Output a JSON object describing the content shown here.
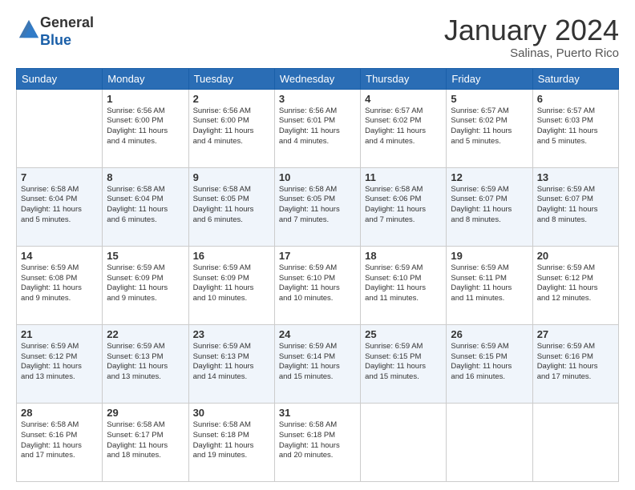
{
  "header": {
    "logo_general": "General",
    "logo_blue": "Blue",
    "month_title": "January 2024",
    "location": "Salinas, Puerto Rico"
  },
  "days_of_week": [
    "Sunday",
    "Monday",
    "Tuesday",
    "Wednesday",
    "Thursday",
    "Friday",
    "Saturday"
  ],
  "weeks": [
    [
      {
        "day": "",
        "info": ""
      },
      {
        "day": "1",
        "info": "Sunrise: 6:56 AM\nSunset: 6:00 PM\nDaylight: 11 hours\nand 4 minutes."
      },
      {
        "day": "2",
        "info": "Sunrise: 6:56 AM\nSunset: 6:00 PM\nDaylight: 11 hours\nand 4 minutes."
      },
      {
        "day": "3",
        "info": "Sunrise: 6:56 AM\nSunset: 6:01 PM\nDaylight: 11 hours\nand 4 minutes."
      },
      {
        "day": "4",
        "info": "Sunrise: 6:57 AM\nSunset: 6:02 PM\nDaylight: 11 hours\nand 4 minutes."
      },
      {
        "day": "5",
        "info": "Sunrise: 6:57 AM\nSunset: 6:02 PM\nDaylight: 11 hours\nand 5 minutes."
      },
      {
        "day": "6",
        "info": "Sunrise: 6:57 AM\nSunset: 6:03 PM\nDaylight: 11 hours\nand 5 minutes."
      }
    ],
    [
      {
        "day": "7",
        "info": "Sunrise: 6:58 AM\nSunset: 6:04 PM\nDaylight: 11 hours\nand 5 minutes."
      },
      {
        "day": "8",
        "info": "Sunrise: 6:58 AM\nSunset: 6:04 PM\nDaylight: 11 hours\nand 6 minutes."
      },
      {
        "day": "9",
        "info": "Sunrise: 6:58 AM\nSunset: 6:05 PM\nDaylight: 11 hours\nand 6 minutes."
      },
      {
        "day": "10",
        "info": "Sunrise: 6:58 AM\nSunset: 6:05 PM\nDaylight: 11 hours\nand 7 minutes."
      },
      {
        "day": "11",
        "info": "Sunrise: 6:58 AM\nSunset: 6:06 PM\nDaylight: 11 hours\nand 7 minutes."
      },
      {
        "day": "12",
        "info": "Sunrise: 6:59 AM\nSunset: 6:07 PM\nDaylight: 11 hours\nand 8 minutes."
      },
      {
        "day": "13",
        "info": "Sunrise: 6:59 AM\nSunset: 6:07 PM\nDaylight: 11 hours\nand 8 minutes."
      }
    ],
    [
      {
        "day": "14",
        "info": "Sunrise: 6:59 AM\nSunset: 6:08 PM\nDaylight: 11 hours\nand 9 minutes."
      },
      {
        "day": "15",
        "info": "Sunrise: 6:59 AM\nSunset: 6:09 PM\nDaylight: 11 hours\nand 9 minutes."
      },
      {
        "day": "16",
        "info": "Sunrise: 6:59 AM\nSunset: 6:09 PM\nDaylight: 11 hours\nand 10 minutes."
      },
      {
        "day": "17",
        "info": "Sunrise: 6:59 AM\nSunset: 6:10 PM\nDaylight: 11 hours\nand 10 minutes."
      },
      {
        "day": "18",
        "info": "Sunrise: 6:59 AM\nSunset: 6:10 PM\nDaylight: 11 hours\nand 11 minutes."
      },
      {
        "day": "19",
        "info": "Sunrise: 6:59 AM\nSunset: 6:11 PM\nDaylight: 11 hours\nand 11 minutes."
      },
      {
        "day": "20",
        "info": "Sunrise: 6:59 AM\nSunset: 6:12 PM\nDaylight: 11 hours\nand 12 minutes."
      }
    ],
    [
      {
        "day": "21",
        "info": "Sunrise: 6:59 AM\nSunset: 6:12 PM\nDaylight: 11 hours\nand 13 minutes."
      },
      {
        "day": "22",
        "info": "Sunrise: 6:59 AM\nSunset: 6:13 PM\nDaylight: 11 hours\nand 13 minutes."
      },
      {
        "day": "23",
        "info": "Sunrise: 6:59 AM\nSunset: 6:13 PM\nDaylight: 11 hours\nand 14 minutes."
      },
      {
        "day": "24",
        "info": "Sunrise: 6:59 AM\nSunset: 6:14 PM\nDaylight: 11 hours\nand 15 minutes."
      },
      {
        "day": "25",
        "info": "Sunrise: 6:59 AM\nSunset: 6:15 PM\nDaylight: 11 hours\nand 15 minutes."
      },
      {
        "day": "26",
        "info": "Sunrise: 6:59 AM\nSunset: 6:15 PM\nDaylight: 11 hours\nand 16 minutes."
      },
      {
        "day": "27",
        "info": "Sunrise: 6:59 AM\nSunset: 6:16 PM\nDaylight: 11 hours\nand 17 minutes."
      }
    ],
    [
      {
        "day": "28",
        "info": "Sunrise: 6:58 AM\nSunset: 6:16 PM\nDaylight: 11 hours\nand 17 minutes."
      },
      {
        "day": "29",
        "info": "Sunrise: 6:58 AM\nSunset: 6:17 PM\nDaylight: 11 hours\nand 18 minutes."
      },
      {
        "day": "30",
        "info": "Sunrise: 6:58 AM\nSunset: 6:18 PM\nDaylight: 11 hours\nand 19 minutes."
      },
      {
        "day": "31",
        "info": "Sunrise: 6:58 AM\nSunset: 6:18 PM\nDaylight: 11 hours\nand 20 minutes."
      },
      {
        "day": "",
        "info": ""
      },
      {
        "day": "",
        "info": ""
      },
      {
        "day": "",
        "info": ""
      }
    ]
  ]
}
